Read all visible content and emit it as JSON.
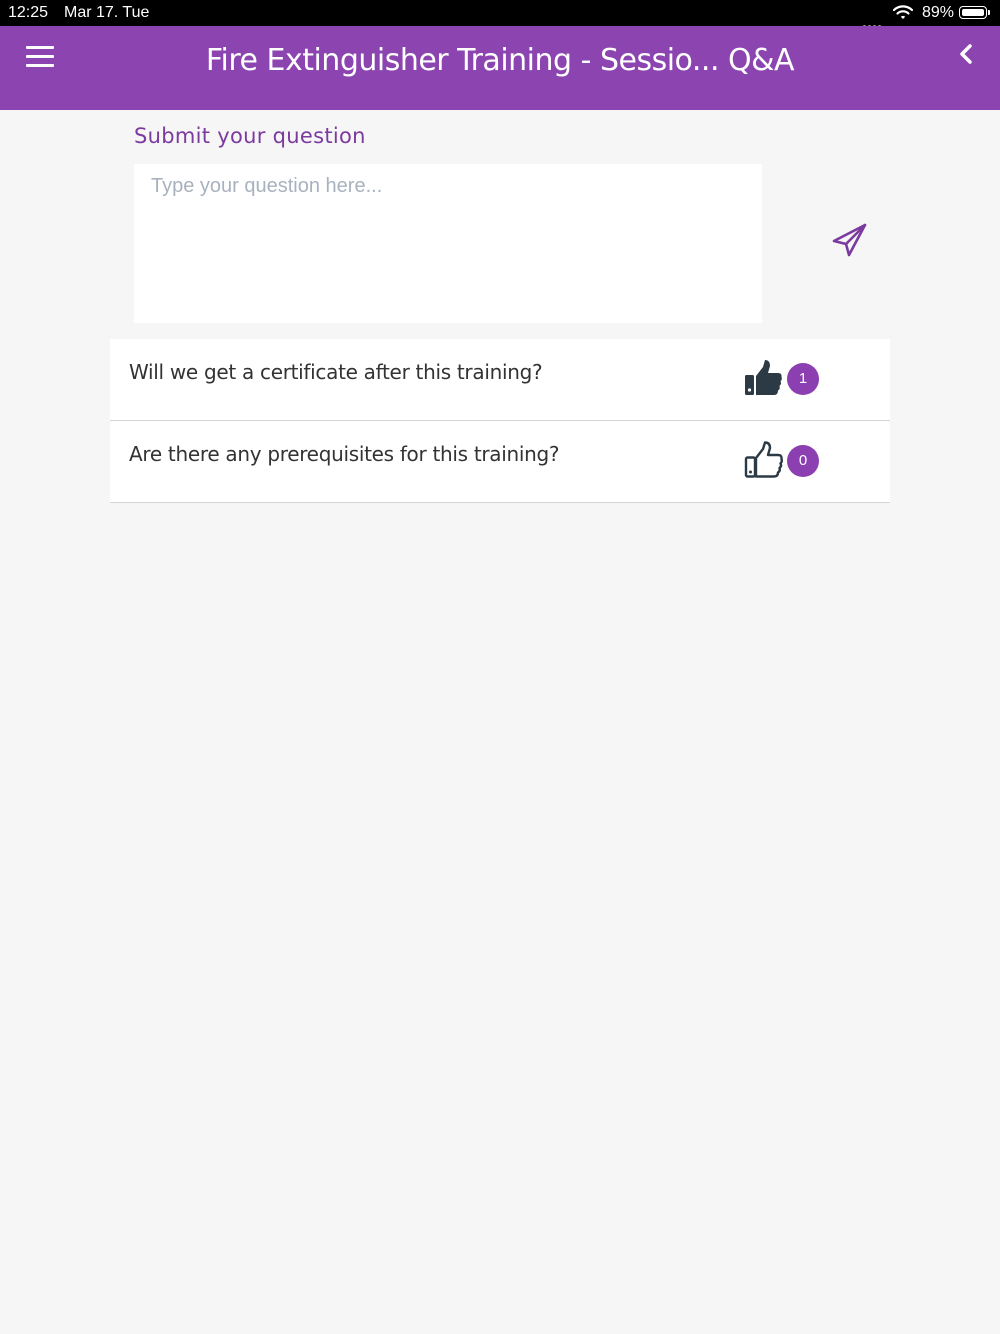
{
  "status_bar": {
    "time": "12:25",
    "date": "Mar 17. Tue",
    "battery": "89%"
  },
  "header": {
    "title": "Fire Extinguisher Training - Sessio... Q&A",
    "menu_icon": "hamburger-menu-icon",
    "back_icon": "chevron-left-icon"
  },
  "submit": {
    "label": "Submit your question",
    "placeholder": "Type your question here...",
    "send_icon": "paper-plane-icon"
  },
  "questions": [
    {
      "text": "Will we get a certificate after this training?",
      "likes": "1",
      "liked": true
    },
    {
      "text": "Are there any prerequisites for this training?",
      "likes": "0",
      "liked": false
    }
  ],
  "colors": {
    "accent": "#8b44b0",
    "badge": "#8b3fb0",
    "label": "#7b3a9e",
    "background": "#f6f6f6"
  }
}
